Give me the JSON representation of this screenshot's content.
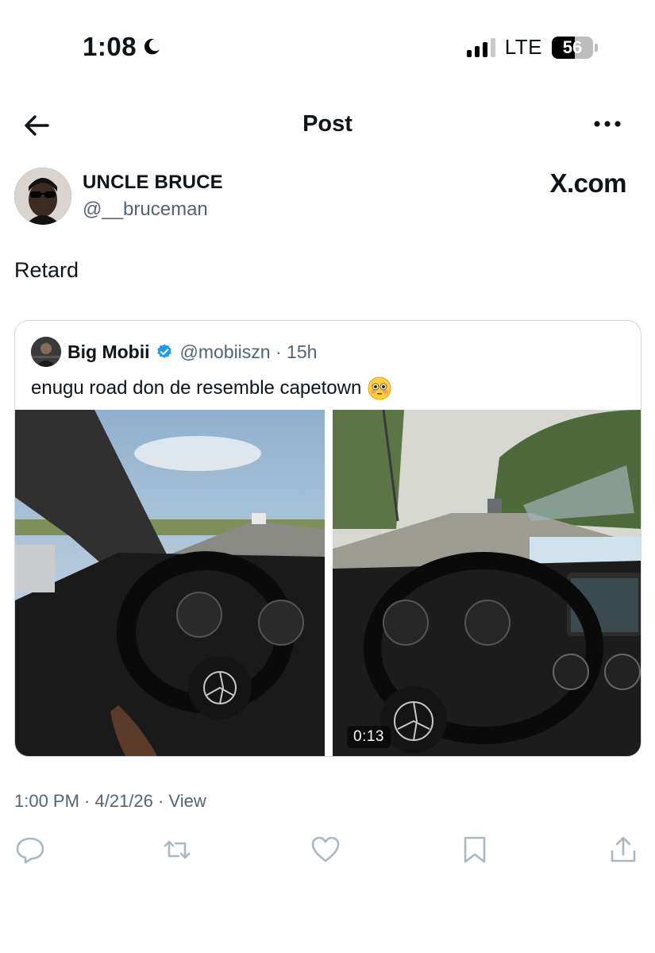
{
  "status_bar": {
    "time": "1:08",
    "network": "LTE",
    "battery": "56",
    "battery_level": 0.56,
    "icons": [
      "moon-icon",
      "signal-icon",
      "battery-icon"
    ]
  },
  "nav": {
    "title": "Post",
    "icons": [
      "back-arrow-icon",
      "more-icon"
    ]
  },
  "post": {
    "display_name": "UNCLE BRUCE",
    "handle": "@__bruceman",
    "watermark": "X.com",
    "text": "Retard",
    "timestamp": "1:00 PM · 4/21/26 · View"
  },
  "quote": {
    "display_name": "Big Mobii",
    "handle_time": "@mobiiszn · 15h",
    "text": "enugu road don de resemble capetown",
    "emoji_icon": "flushed-face-icon",
    "video_duration": "0:13",
    "verified_color": "#1d9bf0"
  },
  "actions": {
    "icons": [
      "reply-icon",
      "repost-icon",
      "like-icon",
      "bookmark-icon",
      "share-icon"
    ],
    "color": "#aab8c2"
  }
}
